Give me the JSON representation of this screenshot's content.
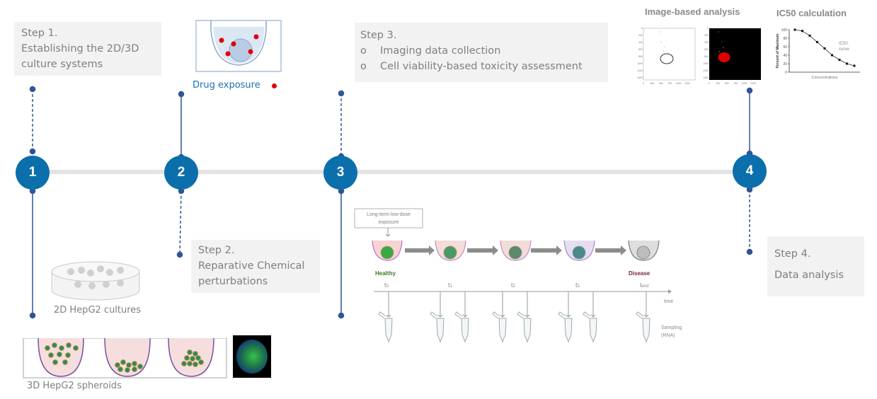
{
  "timeline": {
    "nodes": [
      "1",
      "2",
      "3",
      "4"
    ],
    "accent": "#0b6fac",
    "connector_color": "#2f5597",
    "axis_color": "#e3e3e3"
  },
  "step1": {
    "title": "Step 1.",
    "lines": [
      "Establishing the 2D/3D",
      "culture systems"
    ],
    "caption_2d": "2D HepG2 cultures",
    "caption_3d": "3D HepG2 spheroids"
  },
  "step2": {
    "title": "Step 2.",
    "lines": [
      "Reparative Chemical",
      "perturbations"
    ],
    "drug_label": "Drug exposure",
    "drug_color": "#e00000"
  },
  "step3": {
    "title": "Step 3.",
    "bullet": "o",
    "items": [
      "Imaging data collection",
      "Cell viability-based toxicity assessment"
    ],
    "exposure_box": [
      "Long-term low-dose",
      "exposure"
    ],
    "healthy_label": "Healthy",
    "disease_label": "Disease",
    "healthy_color": "#3d7a1f",
    "disease_color": "#7a1e3c",
    "timepoints": [
      {
        "base": "t",
        "sub": "0"
      },
      {
        "base": "t",
        "sub": "1"
      },
      {
        "base": "t",
        "sub": "2"
      },
      {
        "base": "t",
        "sub": "3"
      },
      {
        "base": "t",
        "sub": "end"
      }
    ],
    "axis_label": "time",
    "sampling_label": [
      "Sampling",
      "(RNA)"
    ]
  },
  "step4": {
    "title": "Step 4.",
    "lines": [
      "Data analysis"
    ],
    "image_analysis_title": "Image-based analysis",
    "ic50_title": "IC50 calculation",
    "image_axis_x_ticks": [
      "0",
      "250",
      "500",
      "750",
      "1000",
      "1250"
    ],
    "image_axis_y_ticks": [
      "0",
      "200",
      "400",
      "600",
      "800",
      "1000",
      "1200",
      "1400"
    ]
  },
  "chart_data": {
    "type": "line",
    "title": "IC50 calculation",
    "xlabel": "Concentrations",
    "ylabel": "Percent of Maximum",
    "annotation": [
      "IC50",
      "curve"
    ],
    "ylim": [
      0,
      100
    ],
    "yticks": [
      "0",
      "20",
      "40",
      "60",
      "80",
      "100"
    ],
    "x": [
      1,
      2,
      3,
      4,
      5,
      6,
      7,
      8,
      9
    ],
    "series": [
      {
        "name": "IC50 curve",
        "values": [
          100,
          97,
          86,
          71,
          56,
          40,
          29,
          20,
          15
        ]
      }
    ],
    "grid": false
  }
}
